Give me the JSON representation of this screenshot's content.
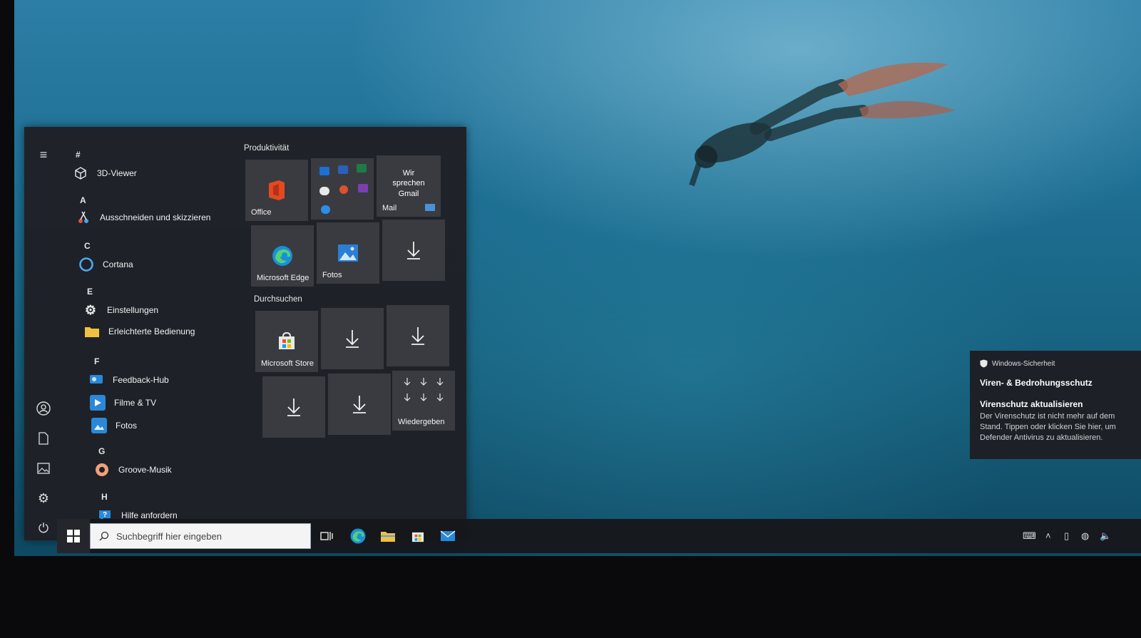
{
  "start_menu": {
    "app_list": [
      {
        "type": "letter",
        "text": "#"
      },
      {
        "type": "app",
        "label": "3D-Viewer",
        "icon": "cube-icon"
      },
      {
        "type": "letter",
        "text": "A"
      },
      {
        "type": "app",
        "label": "Ausschneiden und skizzieren",
        "icon": "snip-icon"
      },
      {
        "type": "letter",
        "text": "C"
      },
      {
        "type": "app",
        "label": "Cortana",
        "icon": "cortana-icon"
      },
      {
        "type": "letter",
        "text": "E"
      },
      {
        "type": "app",
        "label": "Einstellungen",
        "icon": "gear-icon"
      },
      {
        "type": "app",
        "label": "Erleichterte Bedienung",
        "icon": "folder-icon",
        "expandable": true
      },
      {
        "type": "letter",
        "text": "F"
      },
      {
        "type": "app",
        "label": "Feedback-Hub",
        "icon": "feedback-icon"
      },
      {
        "type": "app",
        "label": "Filme & TV",
        "icon": "movies-icon"
      },
      {
        "type": "app",
        "label": "Fotos",
        "icon": "photos-icon"
      },
      {
        "type": "letter",
        "text": "G"
      },
      {
        "type": "app",
        "label": "Groove-Musik",
        "icon": "music-icon"
      },
      {
        "type": "letter",
        "text": "H"
      },
      {
        "type": "app",
        "label": "Hilfe anfordern",
        "icon": "help-icon"
      }
    ],
    "groups": {
      "productivity": "Produktivität",
      "browse": "Durchsuchen"
    },
    "tiles": {
      "office": "Office",
      "mail_headline": "Wir sprechen Gmail",
      "mail": "Mail",
      "edge": "Microsoft Edge",
      "fotos": "Fotos",
      "store": "Microsoft Store",
      "play": "Wiedergeben"
    }
  },
  "taskbar": {
    "search_placeholder": "Suchbegriff hier eingeben",
    "pinned": [
      "task-view-icon",
      "edge-icon",
      "file-explorer-icon",
      "store-icon",
      "mail-icon"
    ]
  },
  "notification": {
    "app": "Windows-Sicherheit",
    "title": "Viren- & Bedrohungsschutz",
    "heading": "Virenschutz aktualisieren",
    "body": "Der Virenschutz ist nicht mehr auf dem Stand. Tippen oder klicken Sie hier, um Defender Antivirus zu aktualisieren."
  },
  "colors": {
    "menu_bg": "#1f2025",
    "tile_bg": "#3a3b41",
    "accent_blue": "#2b88d8"
  }
}
